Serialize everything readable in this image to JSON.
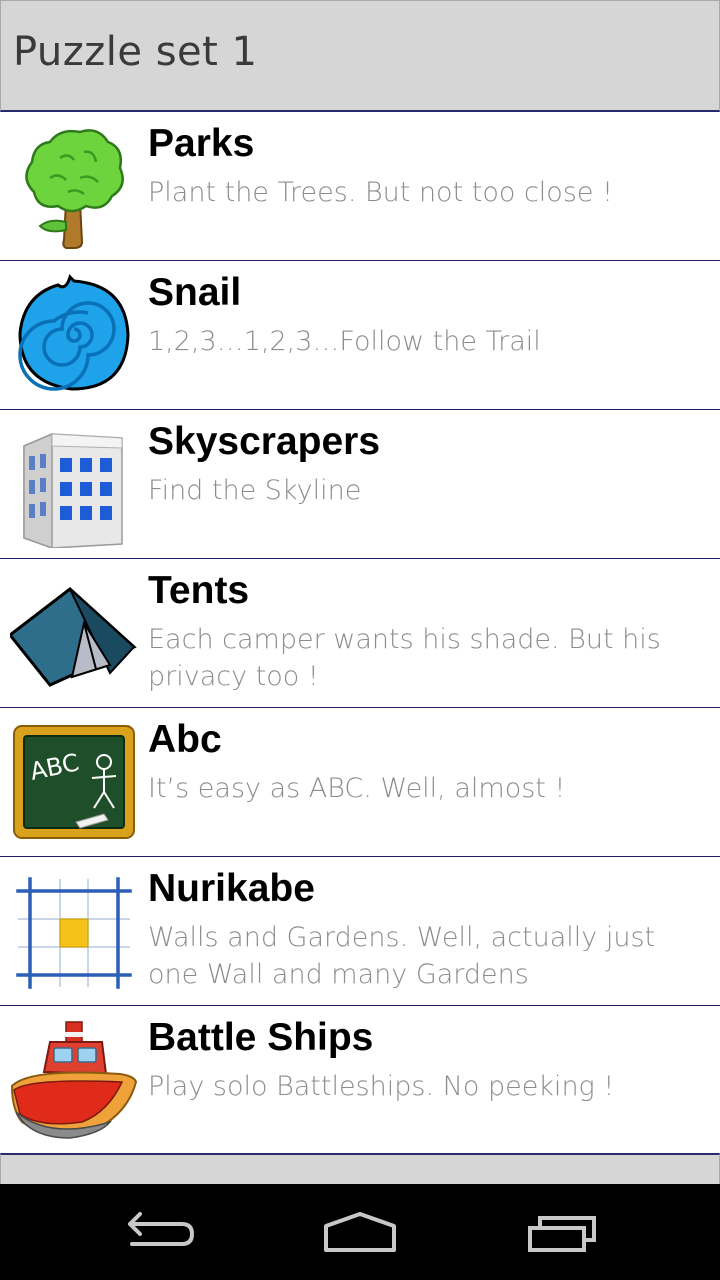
{
  "header": {
    "title": "Puzzle set 1"
  },
  "puzzles": [
    {
      "title": "Parks",
      "description": "Plant the Trees. But not too close !",
      "icon": "tree-icon"
    },
    {
      "title": "Snail",
      "description": "1,2,3…1,2,3…Follow the Trail",
      "icon": "snail-icon"
    },
    {
      "title": "Skyscrapers",
      "description": "Find the Skyline",
      "icon": "building-icon"
    },
    {
      "title": "Tents",
      "description": "Each camper wants his shade. But his privacy too !",
      "icon": "tent-icon"
    },
    {
      "title": "Abc",
      "description": "It’s easy as ABC. Well, almost !",
      "icon": "chalkboard-icon"
    },
    {
      "title": "Nurikabe",
      "description": "Walls and Gardens. Well, actually just one Wall and many Gardens",
      "icon": "grid-icon"
    },
    {
      "title": "Battle Ships",
      "description": "Play solo Battleships. No peeking !",
      "icon": "boat-icon"
    }
  ],
  "navbar": {
    "back": "back-icon",
    "home": "home-icon",
    "recents": "recents-icon"
  },
  "colors": {
    "header_bg": "#d6d6d6",
    "divider": "#1e1e66",
    "title_text": "#000000",
    "desc_text": "#8c8c8c",
    "navbar_bg": "#000000"
  }
}
